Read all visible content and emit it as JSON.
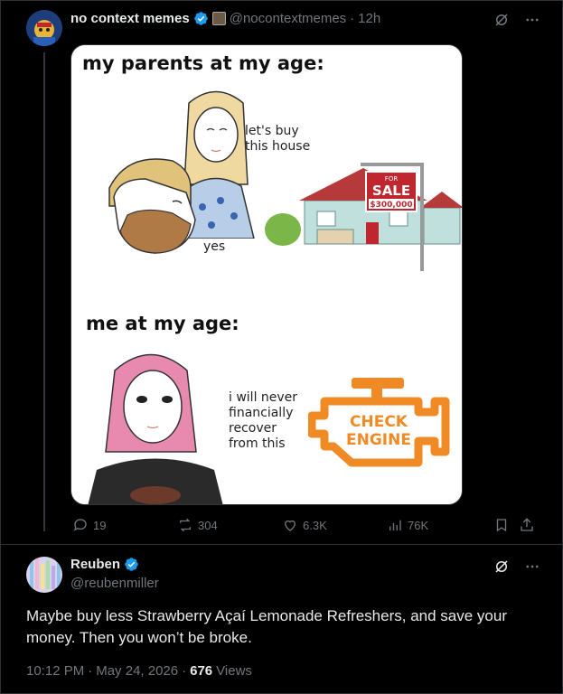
{
  "post": {
    "display_name": "no context memes",
    "handle": "@nocontextmemes",
    "separator": "·",
    "time": "12h",
    "meme": {
      "title_top": "my parents at my age:",
      "speech_woman": "let's buy\nthis house",
      "speech_man": "yes",
      "sign_small": "FOR",
      "sign_big": "SALE",
      "sign_price": "$300,000",
      "title_bottom": "me at my age:",
      "speech_girl": "i will never\nfinancially\nrecover\nfrom this",
      "engine_line1": "CHECK",
      "engine_line2": "ENGINE"
    },
    "actions": {
      "replies": "19",
      "reposts": "304",
      "likes": "6.3K",
      "views": "76K"
    }
  },
  "reply": {
    "display_name": "Reuben",
    "handle": "@reubenmiller",
    "text": "Maybe buy less Strawberry Açaí Lemonade Refreshers, and save your money. Then you won’t be broke.",
    "time": "10:12 PM",
    "date": "May 24, 2026",
    "views_count": "676",
    "views_label": "Views"
  },
  "colors": {
    "background": "#000000",
    "text": "#e7e9ea",
    "muted": "#71767b",
    "verified": "#1d9bf0",
    "border": "#2f3336",
    "engine_orange": "#f08a24",
    "sale_red": "#c0262d"
  },
  "icons": [
    "verified-badge-icon",
    "grok-icon",
    "more-icon",
    "reply-icon",
    "repost-icon",
    "like-icon",
    "views-icon",
    "bookmark-icon",
    "share-icon"
  ]
}
